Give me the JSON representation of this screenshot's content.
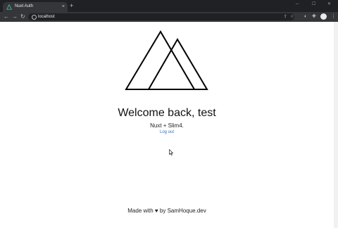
{
  "browser": {
    "tab": {
      "title": "Nuxt Auth",
      "close": "×"
    },
    "new_tab": "+",
    "window_controls": {
      "minimize": "─",
      "maximize": "☐",
      "close": "✕"
    },
    "nav": {
      "back": "←",
      "forward": "→",
      "reload": "↻"
    },
    "address": {
      "url": "localhost"
    },
    "icons": {
      "share": "share-icon",
      "bookmark": "star-icon",
      "extensions": "puzzle-icon",
      "profile": "avatar"
    }
  },
  "page": {
    "logo": "nuxt-logo-icon",
    "welcome": "Welcome back, test",
    "subtitle": "Nuxt + Slim4.",
    "logout": "Log out",
    "footer": "Made with ♥ by SamHoque.dev"
  },
  "colors": {
    "link": "#3b6fb6",
    "tab_favicon": "#41b883"
  }
}
